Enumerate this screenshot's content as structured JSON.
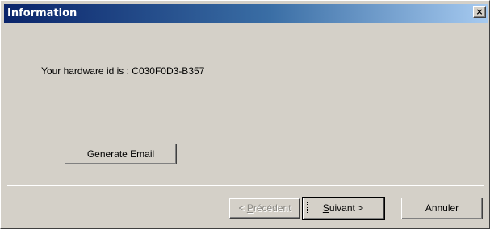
{
  "window": {
    "title": "Information",
    "close_icon": "close-icon",
    "close_glyph": "×"
  },
  "content": {
    "message": "Your hardware id is : C030F0D3-B357"
  },
  "buttons": {
    "generate_email": "Generate Email",
    "previous": {
      "prefix": "< ",
      "mnemonic": "P",
      "rest": "récédent",
      "enabled": false
    },
    "next": {
      "mnemonic": "S",
      "rest": "uivant >",
      "default": true
    },
    "cancel": "Annuler"
  },
  "colors": {
    "dialog_face": "#d4d0c8",
    "title_start": "#0a246a",
    "title_end": "#a6caf0",
    "disabled_text": "#8c8a84"
  }
}
